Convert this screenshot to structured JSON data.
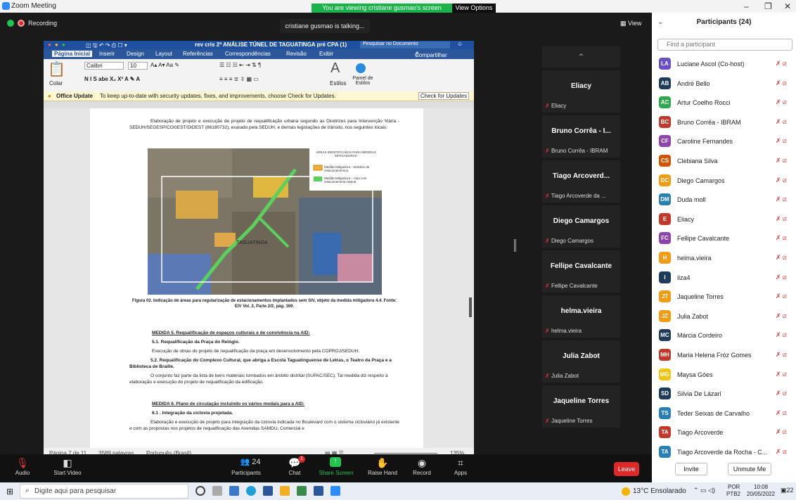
{
  "window": {
    "title": "Zoom Meeting",
    "banner": "You are viewing cristiane gusmao's screen",
    "view_options": "View Options ⌄"
  },
  "meeting": {
    "recording": "Recording",
    "talking": "cristiane gusmao is talking...",
    "view": "View"
  },
  "word": {
    "title": "rev cris 2ª ANÁLISE TÚNEL DE TAGUATINGA pré CPA (1)",
    "search_placeholder": "Pesquisar no Documento",
    "tabs": [
      "Página Inicial",
      "Inserir",
      "Design",
      "Layout",
      "Referências",
      "Correspondências",
      "Revisão",
      "Exibir"
    ],
    "share": "Compartilhar",
    "font": "Calibri",
    "font_size": "10",
    "paste_label": "Colar",
    "styles_label": "Estilos",
    "styles_pane_label": "Painel de Estilos",
    "update_title": "Office Update",
    "update_text": "To keep up-to-date with security updates, fixes, and improvements, choose Check for Updates.",
    "update_button": "Check for Updates",
    "status_page": "Página 7 de 11",
    "status_words": "3589 palavras",
    "status_lang": "Português (Brasil)",
    "status_zoom": "135%",
    "doc": {
      "para1": "Elaboração de projeto e execução de projeto de requalificação urbana segundo as Diretrizes para Intervenção Viária - SEDUH/SEGESP/COGEST/DIDEST (86180732), exarado pela SEDUH, e demais legislações de trânsito, nos seguintes locais:",
      "map_legend_title": "ÁREAS IDENTIFICADAS PARA MEDIDAS MITIGADORAS",
      "map_legend_1": "Medida Mitigadora – Bolsões de estacionamentos.",
      "map_legend_2": "Medida Mitigadora – Vias com estacionamento lateral",
      "map_place": "TAGUATINGA",
      "caption": "Figura 02. Indicação de áreas para regularização de estacionamentos implantados sem SIV, objeto da medida mitigadora 4.4. Fonte: EIV Vol. 2, Parte 2/2, pág. 169.",
      "m5_title": "MEDIDA 5. Requalificação de espaços culturais e de convivência na AID:",
      "m5_1": "5.1. Requalificação da Praça do Relógio.",
      "m5_1_text": "Execução de obras do projeto de requalificação da praça em desenvolvimento pela COPROJ/SEDUH.",
      "m5_2": "5.2. Requalificação do Complexo Cultural, que abriga a Escola Taguatinguense de Letras, o Teatro da Praça e a Biblioteca de Braille.",
      "m5_2_text": "O conjunto faz parte da lista de bens materiais tombados em âmbito distrital (SUPAC/SEC). Tal medida diz respeito à elaboração e execução do projeto de requalificação da edificação.",
      "m6_title": "MEDIDA 6. Plano de circulação incluindo os vários modais para a AID:",
      "m6_1": "6.1 . Integração da ciclovia projetada.",
      "m6_1_text": "Elaboração e execução de projeto para integração da ciclovia indicada no Boulevard com o sistema cicloviário já existente e com as propostas nos projetos de requalificação das Avenidas SAMDU, Comercial e"
    }
  },
  "videos": [
    {
      "big": "Eliacy",
      "label": "Eliacy"
    },
    {
      "big": "Bruno Corrêa - I...",
      "label": "Bruno Corrêa - IBRAM"
    },
    {
      "big": "Tiago Arcoverd...",
      "label": "Tiago Arcoverde da ..."
    },
    {
      "big": "Diego Camargos",
      "label": "Diego Camargos"
    },
    {
      "big": "Fellipe Cavalcante",
      "label": "Fellipe Cavalcante"
    },
    {
      "big": "helma.vieira",
      "label": "helma.vieira"
    },
    {
      "big": "Julia Zabot",
      "label": "Julia Zabot"
    },
    {
      "big": "Jaqueline Torres",
      "label": "Jaqueline Torres"
    }
  ],
  "toolbar": {
    "audio": "Audio",
    "video": "Start Video",
    "participants": "Participants",
    "participants_count": "24",
    "chat": "Chat",
    "chat_badge": "1",
    "share": "Share Screen",
    "raise": "Raise Hand",
    "record": "Record",
    "apps": "Apps",
    "leave": "Leave"
  },
  "panel": {
    "title": "Participants (24)",
    "search_placeholder": "Find a participant",
    "invite": "Invite",
    "unmute": "Unmute Me",
    "participants": [
      {
        "initials": "LA",
        "name": "Luciane Ascol (Co-host)",
        "color": "#6a4fc9"
      },
      {
        "initials": "AB",
        "name": "André Bello",
        "color": "#1f3b5b"
      },
      {
        "initials": "AC",
        "name": "Artur Coelho Rocci",
        "color": "#2fa84f"
      },
      {
        "initials": "BC",
        "name": "Bruno Corrêa - IBRAM",
        "color": "#c0392b"
      },
      {
        "initials": "CF",
        "name": "Caroline Fernandes",
        "color": "#8e44ad"
      },
      {
        "initials": "CS",
        "name": "Clebiana Silva",
        "color": "#d35400"
      },
      {
        "initials": "DC",
        "name": "Diego Camargos",
        "color": "#f39c12"
      },
      {
        "initials": "DM",
        "name": "Duda moll",
        "color": "#2980b9"
      },
      {
        "initials": "E",
        "name": "Eliacy",
        "color": "#c0392b"
      },
      {
        "initials": "FC",
        "name": "Fellipe Cavalcante",
        "color": "#8e44ad"
      },
      {
        "initials": "H",
        "name": "helma.vieira",
        "color": "#f39c12"
      },
      {
        "initials": "I",
        "name": "ilza4",
        "color": "#1f3b5b"
      },
      {
        "initials": "JT",
        "name": "Jaqueline Torres",
        "color": "#f39c12"
      },
      {
        "initials": "JZ",
        "name": "Julia Zabot",
        "color": "#f39c12"
      },
      {
        "initials": "MC",
        "name": "Márcia Cordeiro",
        "color": "#1f3b5b"
      },
      {
        "initials": "MH",
        "name": "Maria Helena Fróz Gomes",
        "color": "#c0392b"
      },
      {
        "initials": "MG",
        "name": "Maysa Góes",
        "color": "#f1c40f"
      },
      {
        "initials": "SD",
        "name": "Silvia De Lázari",
        "color": "#1f3b5b"
      },
      {
        "initials": "TS",
        "name": "Teder Seixas de Carvalho",
        "color": "#2980b9"
      },
      {
        "initials": "TA",
        "name": "Tiago Arcoverde",
        "color": "#c0392b"
      },
      {
        "initials": "TA",
        "name": "Tiago Arcoverde da Rocha - C...",
        "color": "#2980b9"
      }
    ]
  },
  "taskbar": {
    "search_placeholder": "Digite aqui para pesquisar",
    "weather": "13°C Ensolarado",
    "lang1": "POR",
    "lang2": "PTB2",
    "time": "10:08",
    "date": "20/05/2022",
    "notif": "22"
  }
}
